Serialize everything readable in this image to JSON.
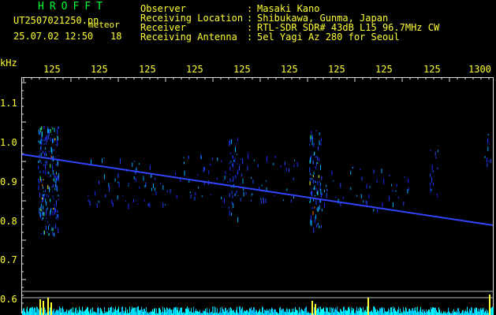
{
  "header": {
    "app_title": "HROFFT",
    "filename": "UT2507021250.pn",
    "filename_suffix": "meteor",
    "datetime": "25.07.02 12:50",
    "count": "18",
    "fields": [
      {
        "label": "Observer",
        "colon": ":",
        "value": "Masaki Kano"
      },
      {
        "label": "Receiving Location",
        "colon": ":",
        "value": "Shibukawa, Gunma, Japan"
      },
      {
        "label": "Receiver",
        "colon": ":",
        "value": "RTL-SDR SDR# 43dB L15 96.7MHz CW"
      },
      {
        "label": "Receiving Antenna",
        "colon": ":",
        "value": "5el Yagi Az 280 for Seoul"
      }
    ]
  },
  "axes": {
    "y_unit": "kHz",
    "y_ticks": [
      "1.1",
      "1.0",
      "0.9",
      "0.8",
      "0.7",
      "0.6"
    ],
    "x_ticks": [
      "125",
      "125",
      "125",
      "125",
      "125",
      "125",
      "125",
      "125",
      "125",
      "1300"
    ]
  },
  "colors": {
    "header_green": "#00ff33",
    "axis_yellow": "#ffff33",
    "trace_blue": "#3344ff",
    "noise_cyan": "#00ffff",
    "frame": "#e0e0e0"
  },
  "chart_data": {
    "type": "heatmap",
    "ylabel": "kHz",
    "ylim": [
      0.6,
      1.1
    ],
    "carrier_line": {
      "start_khz": 0.97,
      "end_khz": 0.82
    },
    "meteor_bursts_x": [
      1251,
      1251.2,
      1254.2,
      1256.8,
      1255.2,
      1259.1,
      1299.7
    ]
  }
}
